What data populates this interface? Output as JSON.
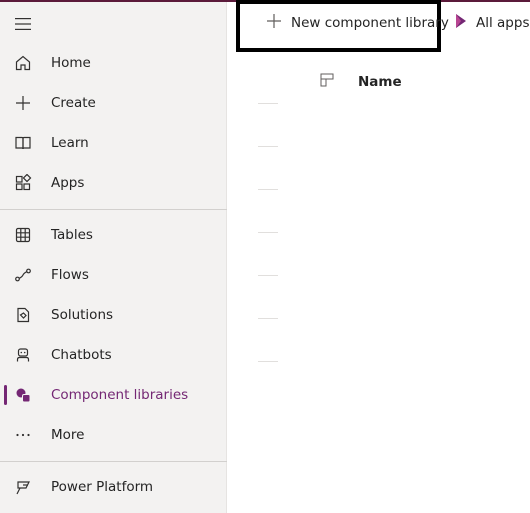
{
  "sidebar": {
    "items": [
      {
        "name": "home",
        "label": "Home",
        "icon": "home-icon"
      },
      {
        "name": "create",
        "label": "Create",
        "icon": "plus-icon"
      },
      {
        "name": "learn",
        "label": "Learn",
        "icon": "book-icon"
      },
      {
        "name": "apps",
        "label": "Apps",
        "icon": "apps-icon"
      },
      {
        "name": "tables",
        "label": "Tables",
        "icon": "table-icon"
      },
      {
        "name": "flows",
        "label": "Flows",
        "icon": "flow-icon"
      },
      {
        "name": "solutions",
        "label": "Solutions",
        "icon": "solutions-icon"
      },
      {
        "name": "chatbots",
        "label": "Chatbots",
        "icon": "bot-icon"
      },
      {
        "name": "component-libraries",
        "label": "Component libraries",
        "icon": "component-library-icon",
        "selected": true
      },
      {
        "name": "more",
        "label": "More",
        "icon": "ellipsis-icon"
      },
      {
        "name": "power-platform",
        "label": "Power Platform",
        "icon": "power-platform-icon"
      }
    ]
  },
  "toolbar": {
    "new_component_library_label": "New component library",
    "all_apps_label": "All apps"
  },
  "table": {
    "columns": [
      {
        "label": "Name"
      }
    ]
  },
  "colors": {
    "accent": "#742774",
    "sidebar_bg": "#f3f2f1",
    "highlight_border": "#000000"
  }
}
